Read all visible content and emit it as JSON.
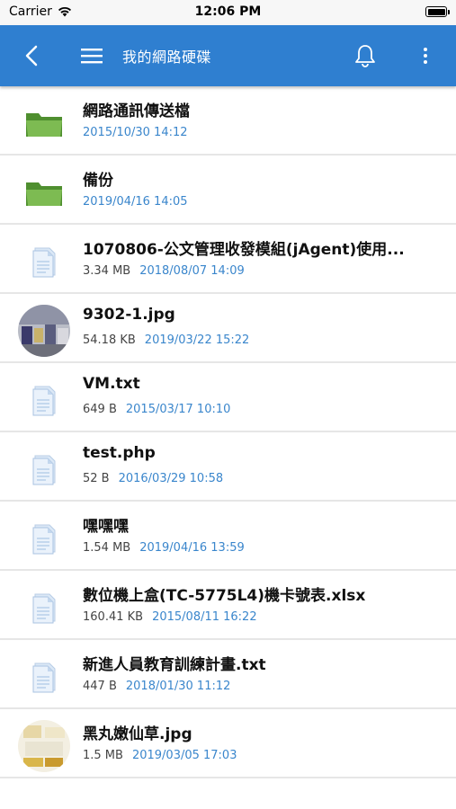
{
  "status": {
    "carrier": "Carrier",
    "time": "12:06 PM"
  },
  "appbar": {
    "title": "我的網路硬碟"
  },
  "colors": {
    "appbar": "#2f7fd0",
    "date": "#3a86cc",
    "folder": "#6cae45"
  },
  "files": [
    {
      "type": "folder",
      "icon": "folder-icon",
      "name": "網路通訊傳送檔",
      "size": "",
      "date": "2015/10/30 14:12"
    },
    {
      "type": "folder",
      "icon": "folder-icon",
      "name": "備份",
      "size": "",
      "date": "2019/04/16 14:05"
    },
    {
      "type": "file",
      "icon": "document-icon",
      "name": "1070806-公文管理收發模組(jAgent)使用...",
      "size": "3.34 MB",
      "date": "2018/08/07 14:09"
    },
    {
      "type": "image",
      "icon": "photo-thumbnail",
      "name": "9302-1.jpg",
      "size": "54.18 KB",
      "date": "2019/03/22 15:22"
    },
    {
      "type": "file",
      "icon": "document-icon",
      "name": "VM.txt",
      "size": "649 B",
      "date": "2015/03/17 10:10"
    },
    {
      "type": "file",
      "icon": "document-icon",
      "name": "test.php",
      "size": "52 B",
      "date": "2016/03/29 10:58"
    },
    {
      "type": "file",
      "icon": "document-icon",
      "name": "嘿嘿嘿",
      "size": "1.54 MB",
      "date": "2019/04/16 13:59"
    },
    {
      "type": "file",
      "icon": "document-icon",
      "name": "數位機上盒(TC-5775L4)機卡號表.xlsx",
      "size": "160.41 KB",
      "date": "2015/08/11 16:22"
    },
    {
      "type": "file",
      "icon": "document-icon",
      "name": "新進人員教育訓練計畫.txt",
      "size": "447 B",
      "date": "2018/01/30 11:12"
    },
    {
      "type": "image",
      "icon": "photo-thumbnail",
      "name": "黑丸嫩仙草.jpg",
      "size": "1.5 MB",
      "date": "2019/03/05 17:03"
    }
  ]
}
